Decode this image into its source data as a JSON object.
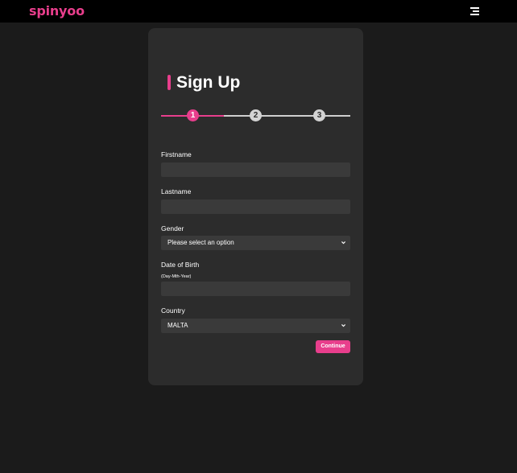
{
  "brand": {
    "logo_text": "spinyoo",
    "accent_color": "#e83e8c"
  },
  "header": {
    "menu_icon": "hamburger-menu-icon"
  },
  "form": {
    "title": "Sign Up",
    "steps": [
      "1",
      "2",
      "3"
    ],
    "active_step": 1,
    "fields": {
      "firstname": {
        "label": "Firstname",
        "value": ""
      },
      "lastname": {
        "label": "Lastname",
        "value": ""
      },
      "gender": {
        "label": "Gender",
        "selected": "Please select an option"
      },
      "dob": {
        "label": "Date of Birth",
        "hint": "(Day-Mth-Year)",
        "value": ""
      },
      "country": {
        "label": "Country",
        "selected": "MALTA"
      }
    },
    "continue_label": "Continue"
  }
}
